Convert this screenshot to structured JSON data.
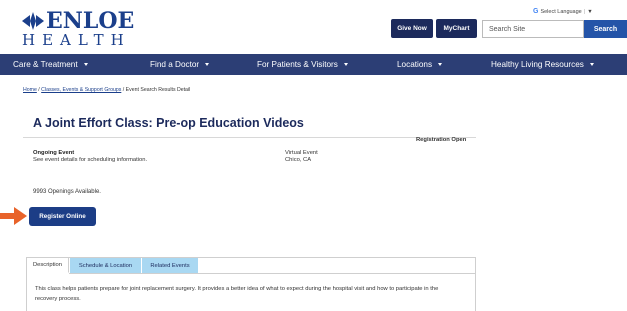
{
  "header": {
    "logo_top": "ENLOE",
    "logo_bottom": "HEALTH",
    "give_now": "Give Now",
    "mychart": "MyChart",
    "language": {
      "g_label": "G",
      "label": "Select Language",
      "sep": "|",
      "arrow": "▼"
    },
    "search_placeholder": "Search Site",
    "search_button": "Search"
  },
  "nav": {
    "items": [
      {
        "label": "Care & Treatment"
      },
      {
        "label": "Find a Doctor"
      },
      {
        "label": "For Patients & Visitors"
      },
      {
        "label": "Locations"
      },
      {
        "label": "Healthy Living Resources"
      }
    ]
  },
  "breadcrumb": {
    "home": "Home",
    "sep1": " / ",
    "classes": "Classes, Events & Support Groups",
    "sep2": " / ",
    "current": "Event Search Results Detail"
  },
  "event": {
    "title": "A Joint Effort Class: Pre-op Education Videos",
    "registration_status": "Registration Open",
    "schedule_type": "Ongoing Event",
    "schedule_note": "See event details for scheduling information.",
    "location_type": "Virtual Event",
    "city": "Chico, CA",
    "openings": "9993 Openings Available.",
    "register_button": "Register Online"
  },
  "tabs": {
    "items": [
      {
        "label": "Description"
      },
      {
        "label": "Schedule & Location"
      },
      {
        "label": "Related Events"
      }
    ],
    "description": "This class helps patients prepare for joint replacement surgery. It provides a better idea of what to expect during the hospital visit and how to participate in the recovery process."
  },
  "colors": {
    "brand_blue": "#1b3f8b",
    "nav_bg": "#2c3e75",
    "button_dark": "#1c2a5c",
    "tab_light": "#a9d8f2",
    "arrow": "#e8632a"
  },
  "icons": {
    "logo_mark": "diamond-arrows-icon",
    "pointer": "arrow-right-icon",
    "dropdown": "chevron-down-icon"
  }
}
